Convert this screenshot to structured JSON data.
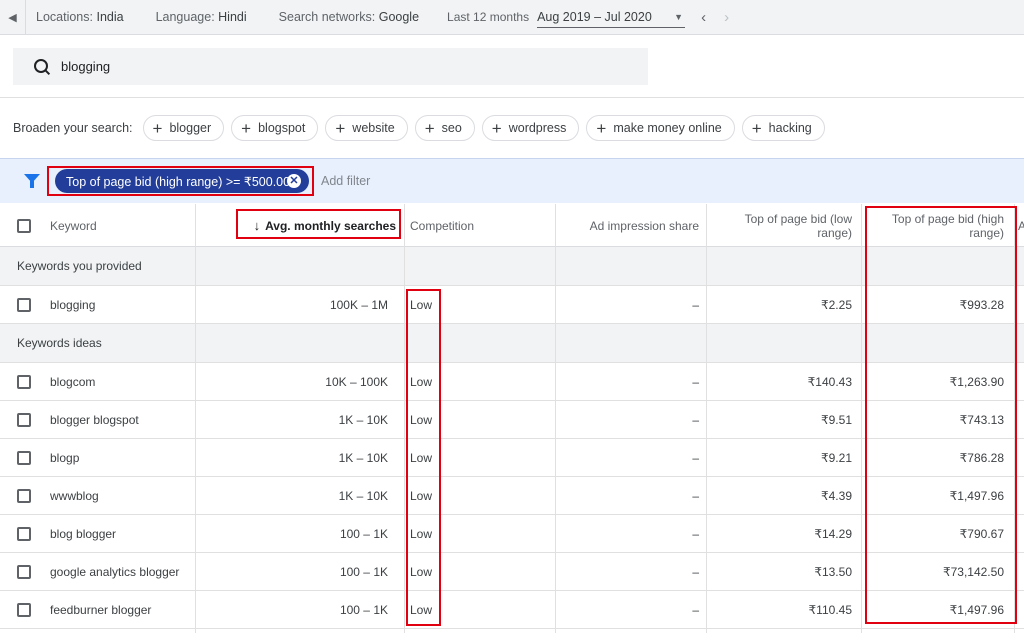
{
  "topbar": {
    "locations_label": "Locations:",
    "locations_value": "India",
    "language_label": "Language:",
    "language_value": "Hindi",
    "networks_label": "Search networks:",
    "networks_value": "Google",
    "period_label": "Last 12 months",
    "date_range": "Aug 2019 – Jul 2020"
  },
  "search": {
    "value": "blogging"
  },
  "broaden": {
    "label": "Broaden your search:",
    "chips": [
      "blogger",
      "blogspot",
      "website",
      "seo",
      "wordpress",
      "make money online",
      "hacking"
    ]
  },
  "filter": {
    "chip_label": "Top of page bid (high range) >= ₹500.00",
    "add_filter": "Add filter"
  },
  "table": {
    "headers": {
      "keyword": "Keyword",
      "avg_searches": "Avg. monthly searches",
      "competition": "Competition",
      "impression_share": "Ad impression share",
      "bid_low": "Top of page bid (low range)",
      "bid_high": "Top of page bid (high range)"
    },
    "section_provided": "Keywords you provided",
    "section_ideas": "Keywords ideas",
    "provided": [
      {
        "keyword": "blogging",
        "volume": "100K – 1M",
        "competition": "Low",
        "impression": "–",
        "bid_low": "₹2.25",
        "bid_high": "₹993.28"
      }
    ],
    "ideas": [
      {
        "keyword": "blogcom",
        "volume": "10K – 100K",
        "competition": "Low",
        "impression": "–",
        "bid_low": "₹140.43",
        "bid_high": "₹1,263.90"
      },
      {
        "keyword": "blogger blogspot",
        "volume": "1K – 10K",
        "competition": "Low",
        "impression": "–",
        "bid_low": "₹9.51",
        "bid_high": "₹743.13"
      },
      {
        "keyword": "blogp",
        "volume": "1K – 10K",
        "competition": "Low",
        "impression": "–",
        "bid_low": "₹9.21",
        "bid_high": "₹786.28"
      },
      {
        "keyword": "wwwblog",
        "volume": "1K – 10K",
        "competition": "Low",
        "impression": "–",
        "bid_low": "₹4.39",
        "bid_high": "₹1,497.96"
      },
      {
        "keyword": "blog blogger",
        "volume": "100 – 1K",
        "competition": "Low",
        "impression": "–",
        "bid_low": "₹14.29",
        "bid_high": "₹790.67"
      },
      {
        "keyword": "google analytics blogger",
        "volume": "100 – 1K",
        "competition": "Low",
        "impression": "–",
        "bid_low": "₹13.50",
        "bid_high": "₹73,142.50"
      },
      {
        "keyword": "feedburner blogger",
        "volume": "100 – 1K",
        "competition": "Low",
        "impression": "–",
        "bid_low": "₹110.45",
        "bid_high": "₹1,497.96"
      }
    ]
  },
  "colors": {
    "accent": "#1a73e8",
    "filter_chip": "#223e9a",
    "highlight": "#e0000f"
  }
}
